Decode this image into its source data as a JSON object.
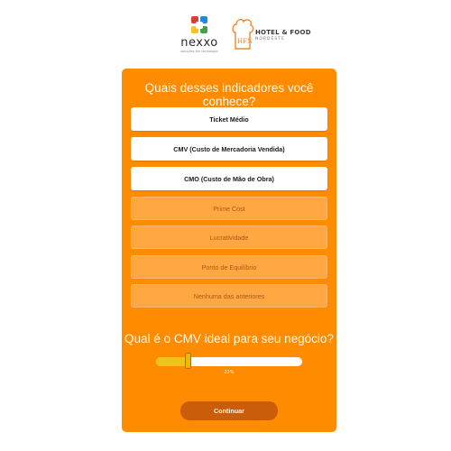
{
  "logos": {
    "nexxo_name": "nexxo",
    "nexxo_tagline": "soluções em tecnologia",
    "hotel_food_mark": "HFN",
    "hotel_food_title": "HOTEL & FOOD",
    "hotel_food_subtitle": "NORDESTE"
  },
  "question1": {
    "text": "Quais desses indicadores você conhece?",
    "options": [
      {
        "label": "Ticket Médio",
        "selected": true
      },
      {
        "label": "CMV (Custo de Mercadoria Vendida)",
        "selected": true
      },
      {
        "label": "CMO (Custo de Mão de Obra)",
        "selected": true
      },
      {
        "label": "Prime Cost",
        "selected": false
      },
      {
        "label": "Lucratividade",
        "selected": false
      },
      {
        "label": "Ponto de Equilíbrio",
        "selected": false
      },
      {
        "label": "Nenhuma das anteriores",
        "selected": false
      }
    ]
  },
  "question2": {
    "text": "Qual é o CMV ideal para seu negócio?",
    "slider_value": 0.22,
    "slider_label": "22%"
  },
  "continue_label": "Continuar",
  "colors": {
    "card": "#ff8c00",
    "selected_option": "#ffffff",
    "unselected_option": "#ffa742",
    "slider_fill": "#f2c21b",
    "button": "#c95d0a"
  },
  "icons": {
    "nexxo": "nexxo-logo-icon",
    "hotel_food": "chef-hat-icon"
  }
}
